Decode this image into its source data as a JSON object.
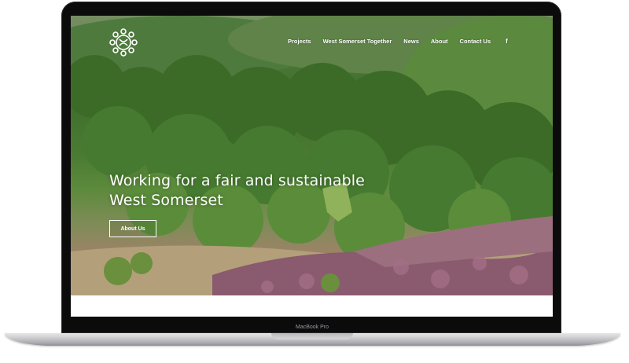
{
  "device": {
    "model_label": "MacBook Pro"
  },
  "site": {
    "logo_icon": "west-somerset-logo-icon",
    "nav": {
      "items": [
        {
          "label": "Projects"
        },
        {
          "label": "West Somerset Together"
        },
        {
          "label": "News"
        },
        {
          "label": "About"
        },
        {
          "label": "Contact Us"
        }
      ],
      "social_icon": "facebook-icon",
      "social_glyph": "f"
    },
    "hero": {
      "headline_line1": "Working for a fair and sustainable",
      "headline_line2": "West Somerset",
      "cta_label": "About Us"
    }
  },
  "colors": {
    "text_on_hero": "#ffffff",
    "bezel": "#0b0b0c",
    "foliage": "#4a7b33",
    "heather": "#8d6a6b"
  }
}
